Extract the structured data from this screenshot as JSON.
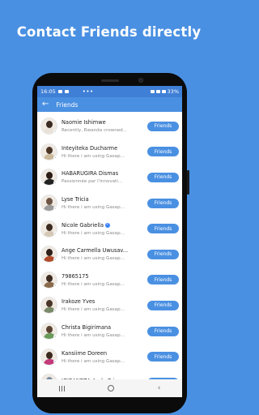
{
  "promo": {
    "title": "Contact Friends directly"
  },
  "status_bar": {
    "time": "16:05",
    "dots": "•••",
    "battery": "33%"
  },
  "app_bar": {
    "title": "Friends"
  },
  "friends": [
    {
      "name": "Naomie Ishimwe",
      "status": "Recently, Rwanda crowned...",
      "button": "Friends",
      "verified": false,
      "skin": "#3b2a22",
      "shirt": "#e8e2d8"
    },
    {
      "name": "Inteyiteka Ducharme",
      "status": "Hi there i am using Gasap...",
      "button": "Friends",
      "verified": false,
      "skin": "#4a3426",
      "shirt": "#c9b89a"
    },
    {
      "name": "HABARUGIRA Dismas",
      "status": "Passionnée par l'innovati...",
      "button": "Friends",
      "verified": false,
      "skin": "#2b1d16",
      "shirt": "#222222"
    },
    {
      "name": "Lyse Tricia",
      "status": "Hi there i am using Gasap...",
      "button": "Friends",
      "verified": false,
      "skin": "#6d5444",
      "shirt": "#9a9a9a"
    },
    {
      "name": "Nicole Gabriella",
      "status": "Hi there i am using Gasap...",
      "button": "Friends",
      "verified": true,
      "skin": "#3a2a20",
      "shirt": "#d6c8b6"
    },
    {
      "name": "Ange Carmella Uwusav...",
      "status": "Hi there i am using Gasap...",
      "button": "Friends",
      "verified": false,
      "skin": "#2e1f18",
      "shirt": "#b04a2a"
    },
    {
      "name": "79865175",
      "status": "Hi there i am using Gasap...",
      "button": "Friends",
      "verified": false,
      "skin": "#3d2b20",
      "shirt": "#8a6a4a"
    },
    {
      "name": "Irakoze Yves",
      "status": "Hi there i am using Gasap...",
      "button": "Friends",
      "verified": false,
      "skin": "#4a3628",
      "shirt": "#7a8a6a"
    },
    {
      "name": "Christa Bigirimana",
      "status": "Hi there i am using Gasap...",
      "button": "Friends",
      "verified": false,
      "skin": "#5a4232",
      "shirt": "#6a9a5a"
    },
    {
      "name": "Kansiime Doreen",
      "status": "Hi there i am using Gasap...",
      "button": "Friends",
      "verified": false,
      "skin": "#3a2a1e",
      "shirt": "#c23a7a"
    },
    {
      "name": "IGIRANEZA Aude Princ...",
      "status": "",
      "button": "Friends",
      "verified": false,
      "skin": "#7a8aa0",
      "shirt": "#4a6aa0"
    }
  ]
}
